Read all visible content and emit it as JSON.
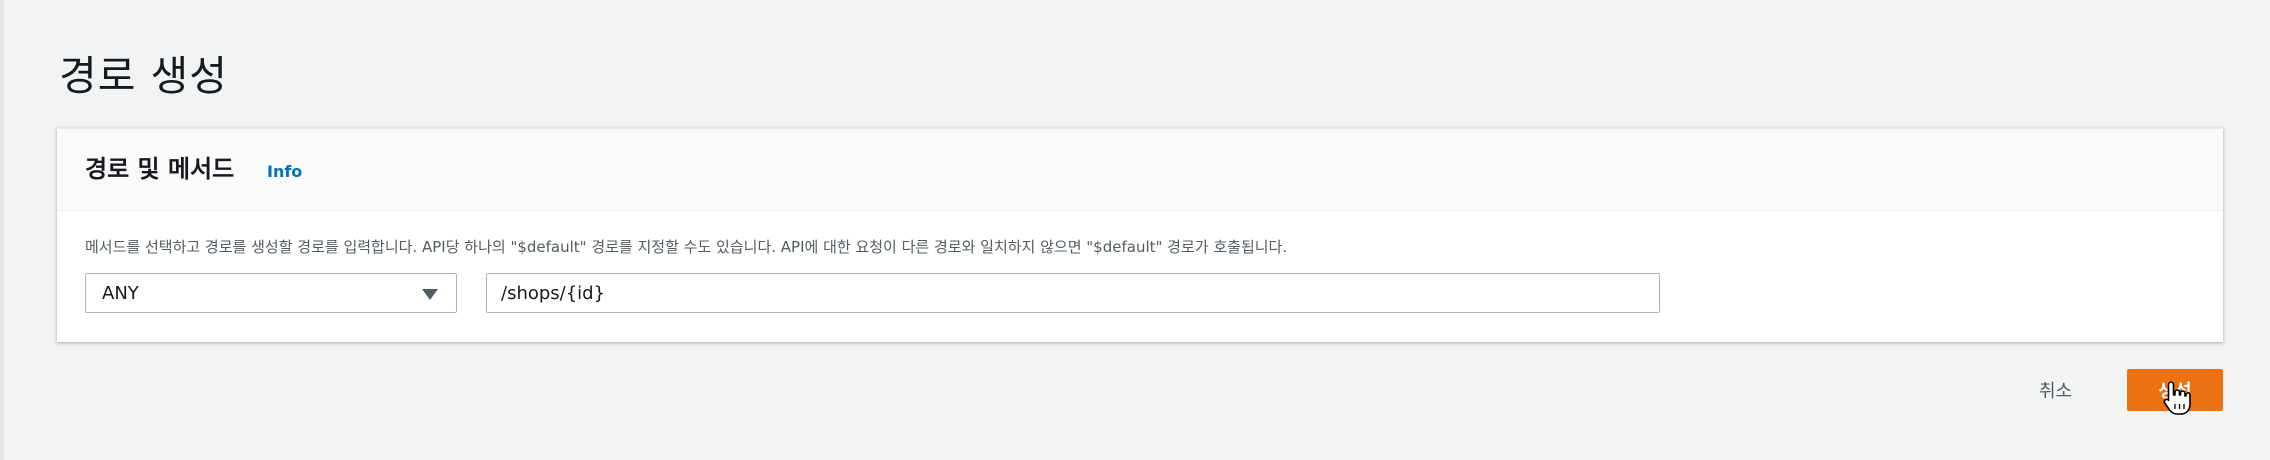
{
  "page": {
    "title": "경로 생성"
  },
  "panel": {
    "title": "경로 및 메서드",
    "info_link": "Info",
    "description": "메서드를 선택하고 경로를 생성할 경로를 입력합니다. API당 하나의 \"$default\" 경로를 지정할 수도 있습니다. API에 대한 요청이 다른 경로와 일치하지 않으면 \"$default\" 경로가 호출됩니다."
  },
  "form": {
    "method_value": "ANY",
    "path_value": "/shops/{id}"
  },
  "actions": {
    "cancel_label": "취소",
    "create_label": "생성"
  },
  "colors": {
    "accent": "#ec7211",
    "link": "#0073bb",
    "background": "#f2f3f3"
  },
  "icons": {
    "dropdown": "caret-down-icon",
    "cursor": "hand-pointer-icon"
  }
}
